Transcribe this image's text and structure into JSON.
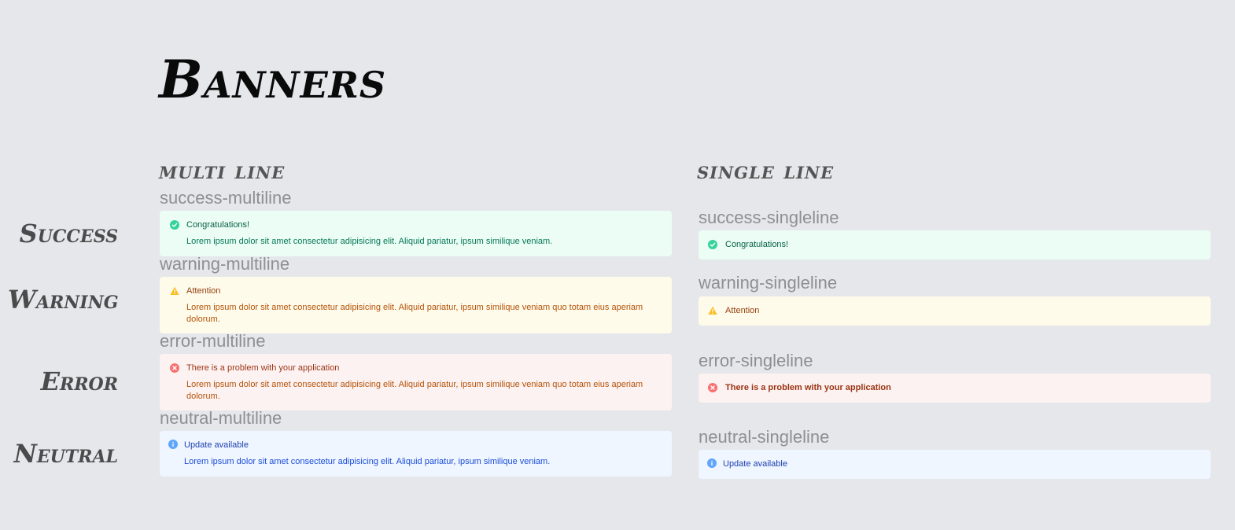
{
  "page": {
    "title": "Banners",
    "columns": {
      "multi": "multi line",
      "single": "single line"
    },
    "rows": {
      "success": "Success",
      "warning": "Warning",
      "error": "Error",
      "neutral": "Neutral"
    }
  },
  "colors": {
    "success_icon": "#34d399",
    "warning_icon": "#fbbf24",
    "error_icon": "#f87171",
    "neutral_icon": "#60a5fa"
  },
  "banners": {
    "success_multi": {
      "caption": "success-multiline",
      "icon": "check-circle-icon",
      "title": "Congratulations!",
      "body": "Lorem ipsum dolor sit amet consectetur adipisicing elit. Aliquid pariatur, ipsum similique veniam."
    },
    "warning_multi": {
      "caption": "warning-multiline",
      "icon": "warning-triangle-icon",
      "title": "Attention",
      "body": "Lorem ipsum dolor sit amet consectetur adipisicing elit. Aliquid pariatur, ipsum similique veniam quo totam eius aperiam dolorum."
    },
    "error_multi": {
      "caption": "error-multiline",
      "icon": "x-circle-icon",
      "title": "There is a problem with your application",
      "body": "Lorem ipsum dolor sit amet consectetur adipisicing elit. Aliquid pariatur, ipsum similique veniam quo totam eius aperiam dolorum."
    },
    "neutral_multi": {
      "caption": "neutral-multiline",
      "icon": "info-circle-icon",
      "title": "Update available",
      "body": "Lorem ipsum dolor sit amet consectetur adipisicing elit. Aliquid pariatur, ipsum similique veniam."
    },
    "success_single": {
      "caption": "success-singleline",
      "icon": "check-circle-icon",
      "title": "Congratulations!"
    },
    "warning_single": {
      "caption": "warning-singleline",
      "icon": "warning-triangle-icon",
      "title": "Attention"
    },
    "error_single": {
      "caption": "error-singleline",
      "icon": "x-circle-icon",
      "title": "There is a problem with your application"
    },
    "neutral_single": {
      "caption": "neutral-singleline",
      "icon": "info-circle-icon",
      "title": "Update available"
    }
  }
}
